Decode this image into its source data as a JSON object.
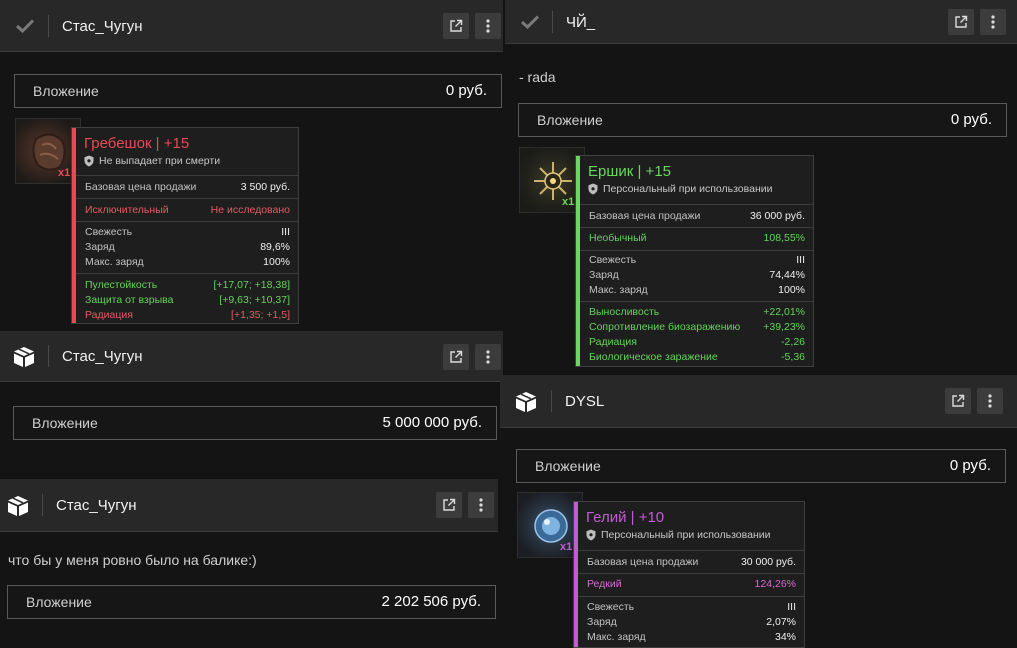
{
  "colors": {
    "accent_red": "#e84a55",
    "accent_green": "#6ad85e",
    "accent_purple": "#c45bd6",
    "header_bg": "#282828"
  },
  "cards": [
    {
      "name": "Стас_Чугун",
      "icon": "check-icon",
      "investment_label": "Вложение",
      "investment_value": "0 руб.",
      "item": {
        "title": "Гребешок | +15",
        "subtitle": "Не выпадает при смерти",
        "qty": "x1",
        "price_label": "Базовая цена продажи",
        "price_value": "3 500 руб.",
        "rarity_label": "Исключительный",
        "rarity_value": "Не исследовано",
        "stats": [
          {
            "label": "Свежесть",
            "value": "III"
          },
          {
            "label": "Заряд",
            "value": "89,6%"
          },
          {
            "label": "Макс. заряд",
            "value": "100%"
          }
        ],
        "effects": [
          {
            "label": "Пулестойкость",
            "value": "[+17,07; +18,38]"
          },
          {
            "label": "Защита от взрыва",
            "value": "[+9,63; +10,37]"
          },
          {
            "label": "Радиация",
            "value": "[+1,35; +1,5]"
          }
        ]
      }
    },
    {
      "name": "ЧЙ_",
      "icon": "check-icon",
      "comment": "- rada",
      "investment_label": "Вложение",
      "investment_value": "0 руб.",
      "item": {
        "title": "Ершик | +15",
        "subtitle": "Персональный при использовании",
        "qty": "x1",
        "price_label": "Базовая цена продажи",
        "price_value": "36 000 руб.",
        "rarity_label": "Необычный",
        "rarity_value": "108,55%",
        "stats": [
          {
            "label": "Свежесть",
            "value": "III"
          },
          {
            "label": "Заряд",
            "value": "74,44%"
          },
          {
            "label": "Макс. заряд",
            "value": "100%"
          }
        ],
        "effects": [
          {
            "label": "Выносливость",
            "value": "+22,01%"
          },
          {
            "label": "Сопротивление биозаражению",
            "value": "+39,23%"
          },
          {
            "label": "Радиация",
            "value": "-2,26"
          },
          {
            "label": "Биологическое заражение",
            "value": "-5,36"
          }
        ]
      }
    },
    {
      "name": "Стас_Чугун",
      "icon": "box-icon",
      "investment_label": "Вложение",
      "investment_value": "5 000 000 руб."
    },
    {
      "name": "DYSL",
      "icon": "box-icon",
      "investment_label": "Вложение",
      "investment_value": "0 руб.",
      "item": {
        "title": "Гелий | +10",
        "subtitle": "Персональный при использовании",
        "qty": "x1",
        "price_label": "Базовая цена продажи",
        "price_value": "30 000 руб.",
        "rarity_label": "Редкий",
        "rarity_value": "124,26%",
        "stats": [
          {
            "label": "Свежесть",
            "value": "III"
          },
          {
            "label": "Заряд",
            "value": "2,07%"
          },
          {
            "label": "Макс. заряд",
            "value": "34%"
          }
        ]
      }
    },
    {
      "name": "Стас_Чугун",
      "icon": "box-icon",
      "comment": "что бы у меня ровно было на балике:)",
      "investment_label": "Вложение",
      "investment_value": "2 202 506 руб."
    }
  ]
}
